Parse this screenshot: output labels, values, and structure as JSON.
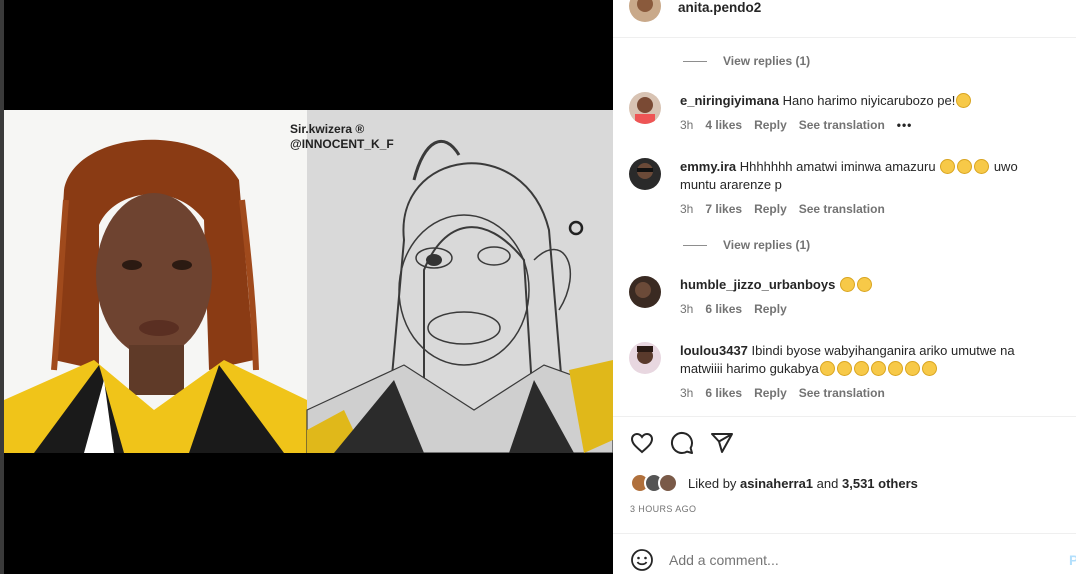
{
  "media": {
    "watermark_line1": "Sir.kwizera ®",
    "watermark_line2": "@INNOCENT_K_F"
  },
  "post_header": {
    "username": "anita.pendo2"
  },
  "comments": [
    {
      "username": "e_niringiyimana",
      "text": "Hano harimo niyicarubozo pe!",
      "emojis": [
        "sad-face"
      ],
      "time": "3h",
      "likes": "4 likes",
      "reply": "Reply",
      "translate": "See translation",
      "more": "•••"
    },
    {
      "username": "emmy.ira",
      "text_line1": "Hhhhhhh amatwi iminwa amazuru",
      "emojis_inline": [
        "surprised-face",
        "laughing-face",
        "laughing-face"
      ],
      "text_tail": "uwo",
      "text_line2": "muntu ararenze p",
      "time": "3h",
      "likes": "7 likes",
      "reply": "Reply",
      "translate": "See translation"
    },
    {
      "username": "humble_jizzo_urbanboys",
      "emojis": [
        "laughing-face",
        "sad-face"
      ],
      "time": "3h",
      "likes": "6 likes",
      "reply": "Reply"
    },
    {
      "username": "loulou3437",
      "text_line1": "Ibindi byose wabyihanganira ariko umutwe na",
      "text_line2": "matwiiii harimo gukabya",
      "emojis": [
        "laughing-face",
        "laughing-face",
        "laughing-face",
        "laughing-face",
        "laughing-face",
        "laughing-face",
        "laughing-face"
      ],
      "time": "3h",
      "likes": "6 likes",
      "reply": "Reply",
      "translate": "See translation"
    }
  ],
  "view_replies": [
    "View replies (1)",
    "View replies (1)"
  ],
  "liked": {
    "prefix": "Liked by",
    "user": "asinaherra1",
    "and": "and",
    "others": "3,531 others"
  },
  "timestamp": "3 HOURS AGO",
  "add_comment": {
    "placeholder": "Add a comment...",
    "post": "P"
  },
  "colors": {
    "accent": "#0095f6",
    "muted": "#737373",
    "emoji": "#f7c948"
  }
}
